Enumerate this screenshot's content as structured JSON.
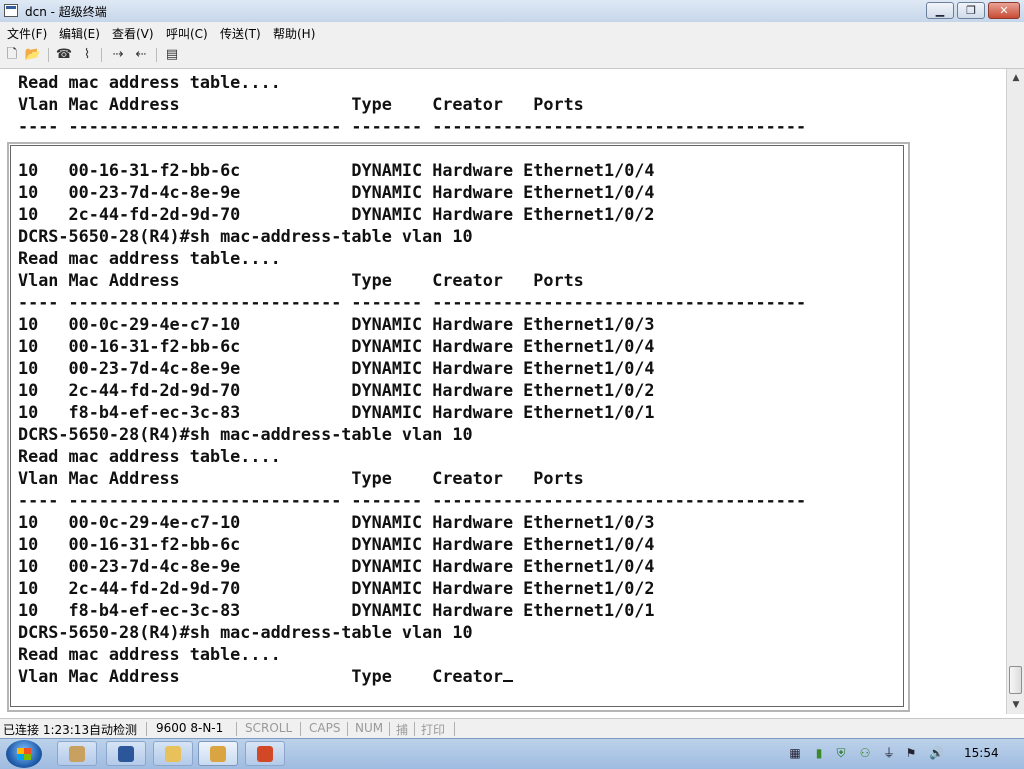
{
  "window": {
    "title": "dcn - 超级终端",
    "minimize_glyph": "▁",
    "maximize_glyph": "❐",
    "close_glyph": "✕"
  },
  "menu": {
    "items": [
      "文件(F)",
      "编辑(E)",
      "查看(V)",
      "呼叫(C)",
      "传送(T)",
      "帮助(H)"
    ]
  },
  "toolbar": {
    "buttons": [
      {
        "icon": "new-file-icon",
        "glyph": "🗋"
      },
      {
        "icon": "open-folder-icon",
        "glyph": "📂"
      },
      {
        "icon": "call-icon",
        "glyph": "☎"
      },
      {
        "icon": "disconnect-icon",
        "glyph": "⌇"
      },
      {
        "icon": "send-icon",
        "glyph": "⇢"
      },
      {
        "icon": "receive-icon",
        "glyph": "⇠"
      },
      {
        "icon": "properties-icon",
        "glyph": "▤"
      }
    ]
  },
  "terminal": {
    "lines": [
      "Read mac address table....",
      "Vlan Mac Address                 Type    Creator   Ports",
      "---- --------------------------- ------- -------------------------------------",
      "",
      "10   00-16-31-f2-bb-6c           DYNAMIC Hardware Ethernet1/0/4",
      "10   00-23-7d-4c-8e-9e           DYNAMIC Hardware Ethernet1/0/4",
      "10   2c-44-fd-2d-9d-70           DYNAMIC Hardware Ethernet1/0/2",
      "DCRS-5650-28(R4)#sh mac-address-table vlan 10",
      "Read mac address table....",
      "Vlan Mac Address                 Type    Creator   Ports",
      "---- --------------------------- ------- -------------------------------------",
      "10   00-0c-29-4e-c7-10           DYNAMIC Hardware Ethernet1/0/3",
      "10   00-16-31-f2-bb-6c           DYNAMIC Hardware Ethernet1/0/4",
      "10   00-23-7d-4c-8e-9e           DYNAMIC Hardware Ethernet1/0/4",
      "10   2c-44-fd-2d-9d-70           DYNAMIC Hardware Ethernet1/0/2",
      "10   f8-b4-ef-ec-3c-83           DYNAMIC Hardware Ethernet1/0/1",
      "DCRS-5650-28(R4)#sh mac-address-table vlan 10",
      "Read mac address table....",
      "Vlan Mac Address                 Type    Creator   Ports",
      "---- --------------------------- ------- -------------------------------------",
      "10   00-0c-29-4e-c7-10           DYNAMIC Hardware Ethernet1/0/3",
      "10   00-16-31-f2-bb-6c           DYNAMIC Hardware Ethernet1/0/4",
      "10   00-23-7d-4c-8e-9e           DYNAMIC Hardware Ethernet1/0/4",
      "10   2c-44-fd-2d-9d-70           DYNAMIC Hardware Ethernet1/0/2",
      "10   f8-b4-ef-ec-3c-83           DYNAMIC Hardware Ethernet1/0/1",
      "DCRS-5650-28(R4)#sh mac-address-table vlan 10",
      "Read mac address table....",
      "Vlan Mac Address                 Type    Creator"
    ]
  },
  "status": {
    "connected": "已连接 1:23:13",
    "detect": "自动检测",
    "port_settings": "9600 8-N-1",
    "scroll": "SCROLL",
    "caps": "CAPS",
    "num": "NUM",
    "capture": "捕",
    "print": "打印"
  },
  "taskbar": {
    "apps": [
      {
        "icon": "hyperterminal-icon",
        "color": "#c8a060"
      },
      {
        "icon": "word-icon",
        "color": "#2b579a"
      },
      {
        "icon": "explorer-icon",
        "color": "#e8c15a"
      },
      {
        "icon": "packages-icon",
        "color": "#d9a441"
      },
      {
        "icon": "powerpoint-icon",
        "color": "#d24726"
      }
    ],
    "tray_icons": [
      {
        "icon": "film-icon",
        "glyph": "▦"
      },
      {
        "icon": "battery-icon",
        "glyph": "▮"
      },
      {
        "icon": "shield-icon",
        "glyph": "⛨"
      },
      {
        "icon": "network-icon",
        "glyph": "⚇"
      },
      {
        "icon": "usb-icon",
        "glyph": "⏚"
      },
      {
        "icon": "flag-icon",
        "glyph": "⚑"
      },
      {
        "icon": "volume-icon",
        "glyph": "🔊"
      }
    ],
    "clock": "15:54"
  }
}
